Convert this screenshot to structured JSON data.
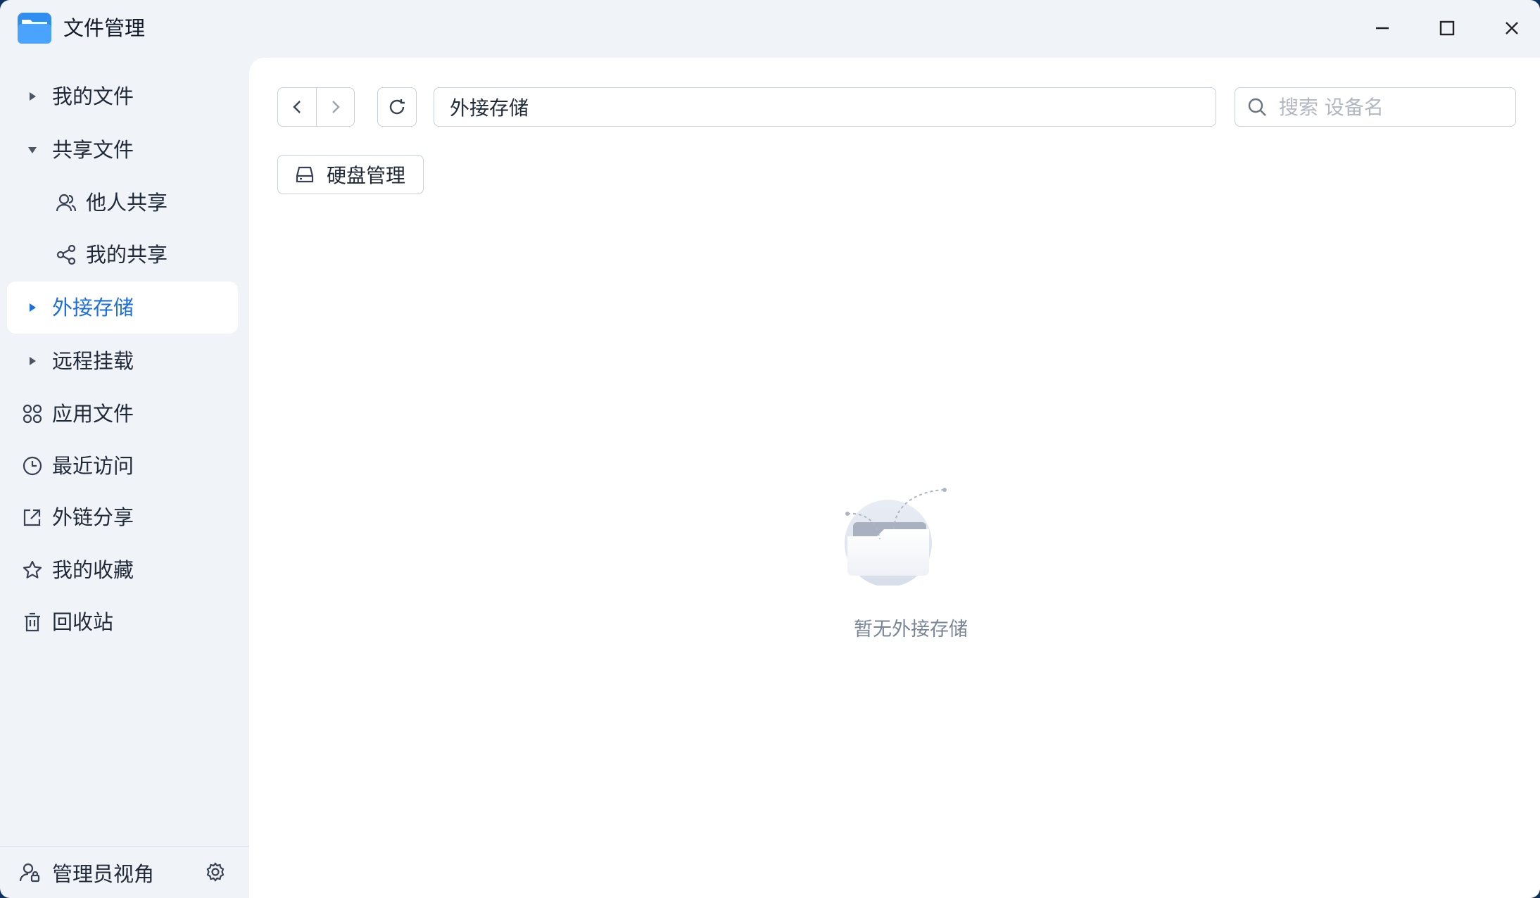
{
  "window": {
    "title": "文件管理",
    "icons": {
      "app": "folder-app-icon",
      "minimize": "minimize-icon",
      "maximize": "maximize-icon",
      "close": "close-icon"
    }
  },
  "sidebar": {
    "items": [
      {
        "label": "我的文件",
        "icon": "caret-right-icon"
      },
      {
        "label": "共享文件",
        "icon": "caret-down-icon",
        "expanded": true
      },
      {
        "label": "他人共享",
        "icon": "users-icon"
      },
      {
        "label": "我的共享",
        "icon": "share-icon"
      },
      {
        "label": "外接存储",
        "icon": "caret-right-icon",
        "active": true
      },
      {
        "label": "远程挂载",
        "icon": "caret-right-icon"
      },
      {
        "label": "应用文件",
        "icon": "apps-icon"
      },
      {
        "label": "最近访问",
        "icon": "clock-icon"
      },
      {
        "label": "外链分享",
        "icon": "external-share-icon"
      },
      {
        "label": "我的收藏",
        "icon": "star-icon"
      },
      {
        "label": "回收站",
        "icon": "trash-icon"
      }
    ],
    "footer": {
      "label": "管理员视角",
      "icon": "admin-user-icon",
      "settings_icon": "gear-icon"
    }
  },
  "toolbar": {
    "path": "外接存储",
    "search_placeholder": "搜索 设备名",
    "disk_manage_label": "硬盘管理"
  },
  "empty_state": {
    "text": "暂无外接存储"
  },
  "colors": {
    "accent": "#1e6fd9",
    "sidebar_bg": "#f0f3f8",
    "main_bg": "#ffffff",
    "border": "#c9d0da"
  }
}
